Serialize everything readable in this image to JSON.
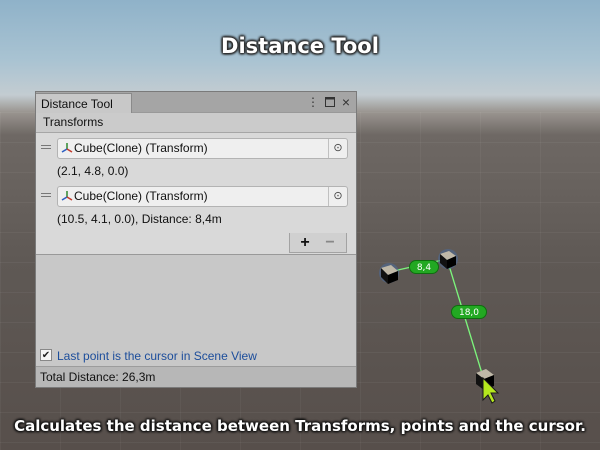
{
  "title": "Distance Tool",
  "caption": "Calculates the distance between Transforms, points and the cursor.",
  "window": {
    "tab_label": "Distance Tool",
    "header": "Transforms",
    "items": [
      {
        "object_label": "Cube(Clone) (Transform)",
        "info": "(2.1, 4.8, 0.0)"
      },
      {
        "object_label": "Cube(Clone) (Transform)",
        "info": "(10.5, 4.1, 0.0), Distance: 8,4m"
      }
    ],
    "add_label": "+",
    "remove_label": "−",
    "toggle_label": "Last point is the cursor in Scene View",
    "toggle_checked": true,
    "footer": "Total Distance: 26,3m"
  },
  "scene": {
    "distance_labels": [
      "8,4",
      "18,0"
    ],
    "line_color": "#7cf57c",
    "badge_color": "#22a822"
  },
  "colors": {
    "accent_link": "#1c4d9b",
    "window_bg": "#c8c8c8"
  }
}
